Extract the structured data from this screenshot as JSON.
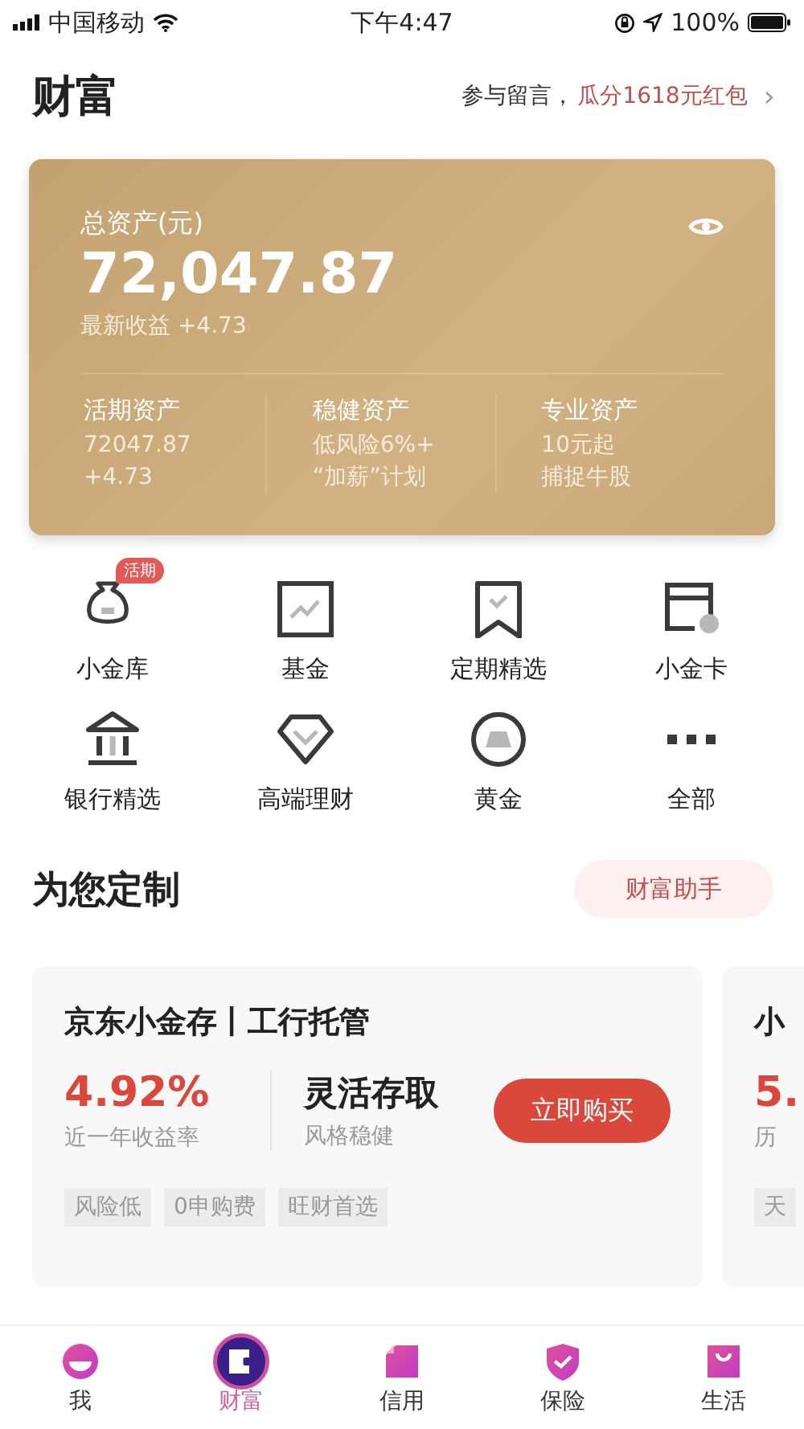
{
  "status_bar": {
    "carrier": "中国移动",
    "time": "下午4:47",
    "battery": "100%"
  },
  "header": {
    "title": "财富",
    "promo_prefix": "参与留言，",
    "promo_highlight": "瓜分1618元红包",
    "chevron": "›"
  },
  "assets": {
    "label": "总资产(元)",
    "total": "72,047.87",
    "earnings": "最新收益 +4.73",
    "columns": [
      {
        "title": "活期资产",
        "line1": "72047.87",
        "line2": "+4.73"
      },
      {
        "title": "稳健资产",
        "line1": "低风险6%+",
        "line2": "“加薪”计划"
      },
      {
        "title": "专业资产",
        "line1": "10元起",
        "line2": "捕捉牛股"
      }
    ]
  },
  "shortcuts": [
    {
      "kind": "pouch",
      "label": "小金库",
      "badge": "活期"
    },
    {
      "kind": "fund",
      "label": "基金"
    },
    {
      "kind": "bookmark",
      "label": "定期精选"
    },
    {
      "kind": "card",
      "label": "小金卡"
    },
    {
      "kind": "bank",
      "label": "银行精选"
    },
    {
      "kind": "diamond",
      "label": "高端理财"
    },
    {
      "kind": "gold",
      "label": "黄金"
    },
    {
      "kind": "more",
      "label": "全部"
    }
  ],
  "section": {
    "title": "为您定制",
    "button": "财富助手"
  },
  "products": [
    {
      "title": "京东小金存丨工行托管",
      "rate": "4.92%",
      "rate_label": "近一年收益率",
      "feature": "灵活存取",
      "feature_label": "风格稳健",
      "button": "立即购买",
      "tags": [
        "风险低",
        "0申购费",
        "旺财首选"
      ]
    },
    {
      "title": "小",
      "rate": "5.",
      "rate_label": "历",
      "tags": [
        "天"
      ]
    }
  ],
  "tab_bar": [
    {
      "kind": "me",
      "label": "我",
      "selected": false
    },
    {
      "kind": "wealth",
      "label": "财富",
      "selected": true
    },
    {
      "kind": "credit",
      "label": "信用",
      "selected": false
    },
    {
      "kind": "insurance",
      "label": "保险",
      "selected": false
    },
    {
      "kind": "life",
      "label": "生活",
      "selected": false
    }
  ]
}
